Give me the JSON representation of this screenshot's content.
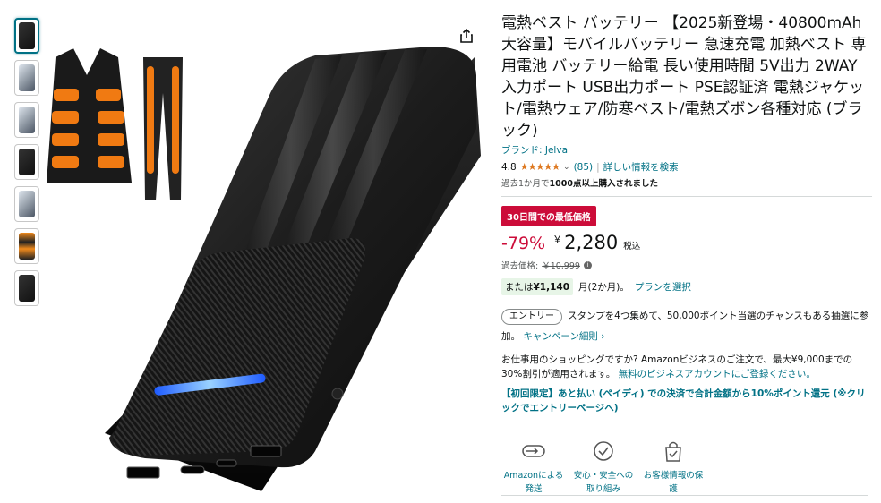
{
  "product": {
    "title": "電熱ベスト バッテリー 【2025新登場・40800mAh大容量】モバイルバッテリー 急速充電 加熱ベスト 専用電池 バッテリー給電 長い使用時間 5V出力 2WAY入力ポート USB出力ポート PSE認証済 電熱ジャケット/電熱ウェア/防寒ベスト/電熱ズボン各種対応 (ブラック)",
    "brand": "ブランド: Jelva",
    "rating": "4.8",
    "stars": "★★★★★",
    "review_count": "(85)",
    "separator": "|",
    "details_link": "詳しい情報を検索",
    "bought_prefix": "過去1か月で",
    "bought_bold": "1000点以上購入されました"
  },
  "price": {
    "deal_badge": "30日間での最低価格",
    "discount": "-79%",
    "currency": "￥",
    "amount": "2,280",
    "tax": "税込",
    "past_label": "過去価格:",
    "past_price": "￥10,999",
    "install_prefix": "または",
    "install_amount": "¥1,140",
    "install_suffix": "月(2か月)。",
    "install_link": "プランを選択"
  },
  "entry": {
    "pill": "エントリー",
    "text": "スタンプを4つ集めて、50,000ポイント当選のチャンスもある抽選に参加。",
    "link": "キャンペーン細則 ›"
  },
  "business": {
    "text": "お仕事用のショッピングですか? Amazonビジネスのご注文で、最大¥9,000までの30%割引が適用されます。",
    "link": "無料のビジネスアカウントにご登録ください。"
  },
  "promo": {
    "text": "【初回限定】あと払い (ペイディ) での決済で合計金額から10%ポイント還元 (※クリックでエントリーページへ)"
  },
  "features": [
    {
      "label": "Amazonによる発送",
      "icon": "truck-icon"
    },
    {
      "label": "安心・安全への取り組み",
      "icon": "shield-check-icon"
    },
    {
      "label": "お客様情報の保護",
      "icon": "lock-bag-icon"
    }
  ],
  "colors": {
    "link": "#007185",
    "deal": "#cc0c39",
    "star": "#de7921"
  }
}
